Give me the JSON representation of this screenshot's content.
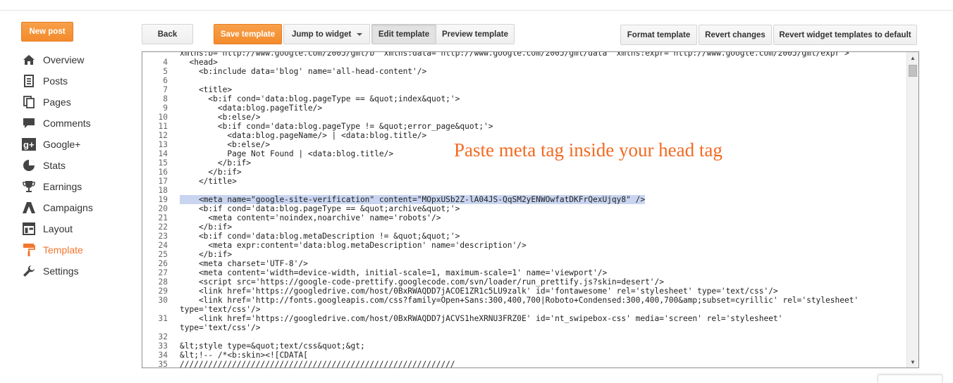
{
  "header": {
    "new_post": "New post"
  },
  "toolbar": {
    "back": "Back",
    "save_template": "Save template",
    "jump_to_widget": "Jump to widget",
    "edit_template": "Edit template",
    "preview_template": "Preview template",
    "format_template": "Format template",
    "revert_changes": "Revert changes",
    "revert_widget_templates": "Revert widget templates to default"
  },
  "sidebar": {
    "items": [
      {
        "label": "Overview",
        "icon": "home-icon",
        "active": false
      },
      {
        "label": "Posts",
        "icon": "posts-icon",
        "active": false
      },
      {
        "label": "Pages",
        "icon": "pages-icon",
        "active": false
      },
      {
        "label": "Comments",
        "icon": "comments-icon",
        "active": false
      },
      {
        "label": "Google+",
        "icon": "google-plus-icon",
        "active": false
      },
      {
        "label": "Stats",
        "icon": "stats-icon",
        "active": false
      },
      {
        "label": "Earnings",
        "icon": "trophy-icon",
        "active": false
      },
      {
        "label": "Campaigns",
        "icon": "campaigns-icon",
        "active": false
      },
      {
        "label": "Layout",
        "icon": "layout-icon",
        "active": false
      },
      {
        "label": "Template",
        "icon": "template-icon",
        "active": true
      },
      {
        "label": "Settings",
        "icon": "wrench-icon",
        "active": false
      }
    ]
  },
  "annotation": "Paste meta tag inside your head tag",
  "code": {
    "lines": [
      {
        "n": "",
        "t": "xmlns:b='http://www.google.com/2005/gml/b' xmlns:data='http://www.google.com/2005/gml/data' xmlns:expr='http://www.google.com/2005/gml/expr'>"
      },
      {
        "n": "4",
        "t": "  <head>"
      },
      {
        "n": "5",
        "t": "    <b:include data='blog' name='all-head-content'/>"
      },
      {
        "n": "6",
        "t": ""
      },
      {
        "n": "7",
        "t": "    <title>"
      },
      {
        "n": "8",
        "t": "      <b:if cond='data:blog.pageType == &quot;index&quot;'>"
      },
      {
        "n": "9",
        "t": "        <data:blog.pageTitle/>"
      },
      {
        "n": "10",
        "t": "        <b:else/>"
      },
      {
        "n": "11",
        "t": "        <b:if cond='data:blog.pageType != &quot;error_page&quot;'>"
      },
      {
        "n": "12",
        "t": "          <data:blog.pageName/> | <data:blog.title/>"
      },
      {
        "n": "13",
        "t": "          <b:else/>"
      },
      {
        "n": "14",
        "t": "          Page Not Found | <data:blog.title/>"
      },
      {
        "n": "15",
        "t": "        </b:if>"
      },
      {
        "n": "16",
        "t": "      </b:if>"
      },
      {
        "n": "17",
        "t": "    </title>"
      },
      {
        "n": "18",
        "t": ""
      },
      {
        "n": "19",
        "t": "    <meta name=\"google-site-verification\" content=\"MOpxUSb2Z-lA04JS-QqSM2yENWOwfatDKFrQexUjqy8\" />",
        "hl": true
      },
      {
        "n": "20",
        "t": "    <b:if cond='data:blog.pageType == &quot;archive&quot;'>"
      },
      {
        "n": "21",
        "t": "      <meta content='noindex,noarchive' name='robots'/>"
      },
      {
        "n": "22",
        "t": "    </b:if>"
      },
      {
        "n": "23",
        "t": "    <b:if cond='data:blog.metaDescription != &quot;&quot;'>"
      },
      {
        "n": "24",
        "t": "      <meta expr:content='data:blog.metaDescription' name='description'/>"
      },
      {
        "n": "25",
        "t": "    </b:if>"
      },
      {
        "n": "26",
        "t": "    <meta charset='UTF-8'/>"
      },
      {
        "n": "27",
        "t": "    <meta content='width=device-width, initial-scale=1, maximum-scale=1' name='viewport'/>"
      },
      {
        "n": "28",
        "t": "    <script src='https://google-code-prettify.googlecode.com/svn/loader/run_prettify.js?skin=desert'/>"
      },
      {
        "n": "29",
        "t": "    <link href='https://googledrive.com/host/0BxRWAQDD7jACOE1ZR1c5LU9zalk' id='fontawesome' rel='stylesheet' type='text/css'/>"
      },
      {
        "n": "30",
        "t": "    <link href='http://fonts.googleapis.com/css?family=Open+Sans:300,400,700|Roboto+Condensed:300,400,700&amp;subset=cyrillic' rel='stylesheet'"
      },
      {
        "n": "",
        "t": "type='text/css'/>"
      },
      {
        "n": "31",
        "t": "    <link href='https://googledrive.com/host/0BxRWAQDD7jACVS1heXRNU3FRZ0E' id='nt_swipebox-css' media='screen' rel='stylesheet'"
      },
      {
        "n": "",
        "t": "type='text/css'/>"
      },
      {
        "n": "32",
        "t": ""
      },
      {
        "n": "33",
        "t": "&lt;style type=&quot;text/css&quot;&gt;"
      },
      {
        "n": "34",
        "t": "&lt;!-- /*<b:skin><![CDATA["
      },
      {
        "n": "35",
        "t": "//////////////////////////////////////////////////////////"
      }
    ]
  }
}
